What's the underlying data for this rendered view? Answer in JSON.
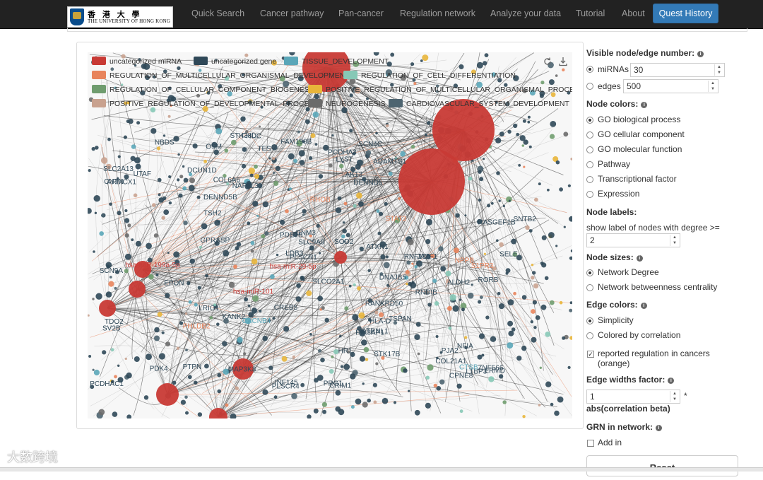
{
  "navbar": {
    "logo": {
      "zh": "香 港 大 學",
      "en": "THE UNIVERSITY OF HONG KONG"
    },
    "items": [
      {
        "label": "Quick Search"
      },
      {
        "label": "Cancer pathway"
      },
      {
        "label": "Pan-cancer"
      },
      {
        "label": "Regulation network"
      },
      {
        "label": "Analyze your data"
      },
      {
        "label": "Tutorial"
      },
      {
        "label": "About"
      }
    ],
    "active": {
      "label": "Quest History"
    }
  },
  "graph": {
    "toolbar": {
      "refresh_icon": "refresh-icon",
      "download_icon": "download-icon"
    },
    "legend": [
      {
        "label": "uncategorized miRNA",
        "color": "#c83a35"
      },
      {
        "label": "uncategorized gene",
        "color": "#2f4858"
      },
      {
        "label": "TISSUE_DEVELOPMENT",
        "color": "#5aa6b8"
      },
      {
        "label": "REGULATION_OF_MULTICELLULAR_ORGANISMAL_DEVELOPMENT",
        "color": "#e8845c"
      },
      {
        "label": "REGULATION_OF_CELL_DIFFERENTIATION",
        "color": "#86c8b6"
      },
      {
        "label": "REGULATION_OF_CELLULAR_COMPONENT_BIOGENESIS",
        "color": "#6f9c6e"
      },
      {
        "label": "POSITIVE_REGULATION_OF_MULTICELLULAR_ORGANISMAL_PROCESS",
        "color": "#e8b53a"
      },
      {
        "label": "POSITIVE_REGULATION_OF_DEVELOPMENTAL_PROCESS",
        "color": "#c9a28f"
      },
      {
        "label": "NEUROGENESIS",
        "color": "#6b6b6b"
      },
      {
        "label": "CARDIOVASCULAR_SYSTEM_DEVELOPMENT",
        "color": "#4d6470"
      }
    ],
    "node_labels": [
      {
        "text": "ATXN1",
        "color": "#2f4858"
      },
      {
        "text": "JAZF1",
        "color": "#2f4858"
      },
      {
        "text": "CREB5",
        "color": "#2f4858"
      },
      {
        "text": "AK13",
        "color": "#2f4858"
      },
      {
        "text": "LRIG1",
        "color": "#2f4858"
      },
      {
        "text": "PCDHA3",
        "color": "#2f4858"
      },
      {
        "text": "NAP1L3",
        "color": "#2f4858"
      },
      {
        "text": "HR1",
        "color": "#2f4858"
      },
      {
        "text": "PLSCR4",
        "color": "#2f4858"
      },
      {
        "text": "TSH2",
        "color": "#2f4858"
      },
      {
        "text": "DNM3",
        "color": "#2f4858"
      },
      {
        "text": "ARMCX1",
        "color": "#2f4858"
      },
      {
        "text": "RNF180",
        "color": "#2f4858"
      },
      {
        "text": "RNDIB",
        "color": "#2f4858"
      },
      {
        "text": "PCDHAC1",
        "color": "#2f4858"
      },
      {
        "text": "CRIM1",
        "color": "#2f4858"
      },
      {
        "text": "OSM",
        "color": "#2f4858"
      },
      {
        "text": "LYST",
        "color": "#2f4858"
      },
      {
        "text": "RORB",
        "color": "#2f4858"
      },
      {
        "text": "MAP3K8",
        "color": "#2f4858"
      },
      {
        "text": "STK17B",
        "color": "#2f4858"
      },
      {
        "text": "DCUN1D",
        "color": "#2f4858"
      },
      {
        "text": "DNAJB5",
        "color": "#2f4858"
      },
      {
        "text": "STK38L",
        "color": "#2f4858"
      },
      {
        "text": "SNTB2",
        "color": "#2f4858"
      },
      {
        "text": "ERMD",
        "color": "#2f4858"
      },
      {
        "text": "PRG1",
        "color": "#2f4858"
      },
      {
        "text": "TES",
        "color": "#2f4858"
      },
      {
        "text": "UTAF",
        "color": "#2f4858"
      },
      {
        "text": "NBDS",
        "color": "#2f4858"
      },
      {
        "text": "INF145",
        "color": "#2f4858"
      },
      {
        "text": "RANKRD50",
        "color": "#2f4858"
      },
      {
        "text": "PIK3AP1",
        "color": "#2f4858"
      },
      {
        "text": "ATRNL1",
        "color": "#2f4858"
      },
      {
        "text": "ZNF566",
        "color": "#2f4858"
      },
      {
        "text": "PDK4",
        "color": "#2f4858"
      },
      {
        "text": "NFIA",
        "color": "#2f4858"
      },
      {
        "text": "PJA2",
        "color": "#2f4858"
      },
      {
        "text": "RASGEF1B",
        "color": "#2f4858"
      },
      {
        "text": "LTBP3",
        "color": "#2f4858"
      },
      {
        "text": "DENND5",
        "color": "#2f4858"
      },
      {
        "text": "HLA-D",
        "color": "#2f4858"
      },
      {
        "text": "SLC2A13",
        "color": "#2f4858"
      },
      {
        "text": "SCN9A",
        "color": "#2f4858"
      },
      {
        "text": "SELE",
        "color": "#2f4858"
      },
      {
        "text": "FAM198B",
        "color": "#2f4858"
      },
      {
        "text": "CPNE8",
        "color": "#2f4858"
      },
      {
        "text": "CNTN",
        "color": "#2f4858"
      },
      {
        "text": "SOD2",
        "color": "#2f4858"
      },
      {
        "text": "TDO2",
        "color": "#2f4858"
      },
      {
        "text": "LDB3",
        "color": "#2f4858"
      },
      {
        "text": "PDE7B",
        "color": "#2f4858"
      },
      {
        "text": "KANK2",
        "color": "#2f4858"
      },
      {
        "text": "SLC9A9",
        "color": "#2f4858"
      },
      {
        "text": "TSPAN",
        "color": "#2f4858"
      },
      {
        "text": "COL6A6",
        "color": "#2f4858"
      },
      {
        "text": "DENND5B",
        "color": "#2f4858"
      },
      {
        "text": "SCN4C",
        "color": "#2f4858"
      },
      {
        "text": "GPRASP",
        "color": "#2f4858"
      },
      {
        "text": "CTSB",
        "color": "#5aa6b8"
      },
      {
        "text": "STAT3",
        "color": "#e8845c"
      },
      {
        "text": "NPPB",
        "color": "#e8845c"
      },
      {
        "text": "PHLDB2",
        "color": "#e8845c"
      },
      {
        "text": "RHOB",
        "color": "#e8845c"
      },
      {
        "text": "S1PR3",
        "color": "#e8845c"
      },
      {
        "text": "CACNB4",
        "color": "#5aa6b8"
      },
      {
        "text": "ADAMTS1",
        "color": "#2f4858"
      },
      {
        "text": "PTPN",
        "color": "#2f4858"
      },
      {
        "text": "PLSCR1",
        "color": "#2f4858"
      },
      {
        "text": "SLCO2A1",
        "color": "#2f4858"
      },
      {
        "text": "COL21A1",
        "color": "#2f4858"
      },
      {
        "text": "hsa-miR-199a-5p",
        "color": "#c83a35"
      },
      {
        "text": "hsa-miR-29-5p",
        "color": "#c83a35"
      },
      {
        "text": "hsa-miR-101",
        "color": "#c83a35"
      },
      {
        "text": "SV2B",
        "color": "#2f4858"
      },
      {
        "text": "FHDC",
        "color": "#2f4858"
      },
      {
        "text": "ALDH2",
        "color": "#2f4858"
      },
      {
        "text": "EPON",
        "color": "#2f4858"
      }
    ]
  },
  "controls": {
    "visible": {
      "title": "Visible node/edge number:",
      "mirnas_label": "miRNAs",
      "mirnas_value": "30",
      "edges_label": "edges",
      "edges_value": "500",
      "selected": "miRNAs"
    },
    "node_colors": {
      "title": "Node colors:",
      "options": [
        "GO biological process",
        "GO cellular component",
        "GO molecular function",
        "Pathway",
        "Transcriptional factor",
        "Expression"
      ],
      "selected": "GO biological process"
    },
    "node_labels": {
      "title": "Node labels:",
      "desc": "show label of nodes with degree >=",
      "value": "2"
    },
    "node_sizes": {
      "title": "Node sizes:",
      "options": [
        "Network Degree",
        "Network betweenness centrality"
      ],
      "selected": "Network Degree"
    },
    "edge_colors": {
      "title": "Edge colors:",
      "options": [
        "Simplicity",
        "Colored by correlation"
      ],
      "selected": "Simplicity",
      "reported_label_1": "reported regulation in cancers",
      "reported_label_2": "(orange)",
      "reported_checked": true
    },
    "edge_widths": {
      "title": "Edge widths factor:",
      "value": "1",
      "suffix_star": "*",
      "suffix": "abs(correlation beta)"
    },
    "grn": {
      "title": "GRN in network:",
      "add_label": "Add in",
      "checked": false
    },
    "reset_label": "Reset"
  },
  "watermark": "大数跨境"
}
